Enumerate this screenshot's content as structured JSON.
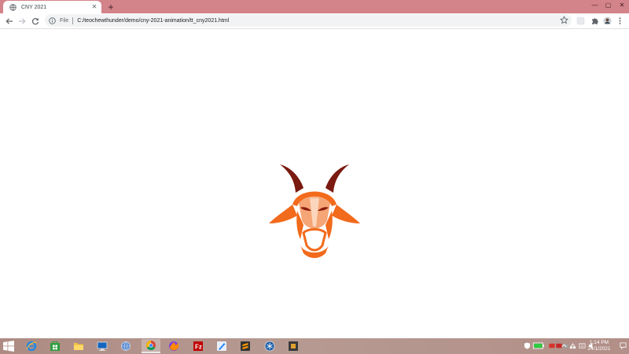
{
  "browser": {
    "tab": {
      "title": "CNY 2021",
      "favicon": "globe-icon",
      "close": "✕"
    },
    "new_tab": "+",
    "window_controls": {
      "minimize": "—",
      "maximize": "▢",
      "close": "✕"
    },
    "address": {
      "scheme": "File",
      "url": "C:/teochewthunder/demo/cny-2021-animation/tt_cny2021.html"
    },
    "colors": {
      "titlebar": "#d3838a",
      "omnibox": "#f1f3f4"
    }
  },
  "content": {
    "illustration": "goat-head",
    "colors": {
      "dark_horn": "#7a1a10",
      "orange": "#f26a1b",
      "light": "#f5a576",
      "eyes": "#8b1a0c"
    }
  },
  "taskbar": {
    "apps": [
      "internet-explorer",
      "store",
      "file-explorer",
      "remote-desktop",
      "network",
      "chrome",
      "firefox",
      "filezilla",
      "git-client",
      "sublime-text",
      "app-blue",
      "app-box"
    ],
    "active_app": "chrome",
    "clock": {
      "time": "1:14 PM",
      "date": "24/1/2021"
    }
  }
}
